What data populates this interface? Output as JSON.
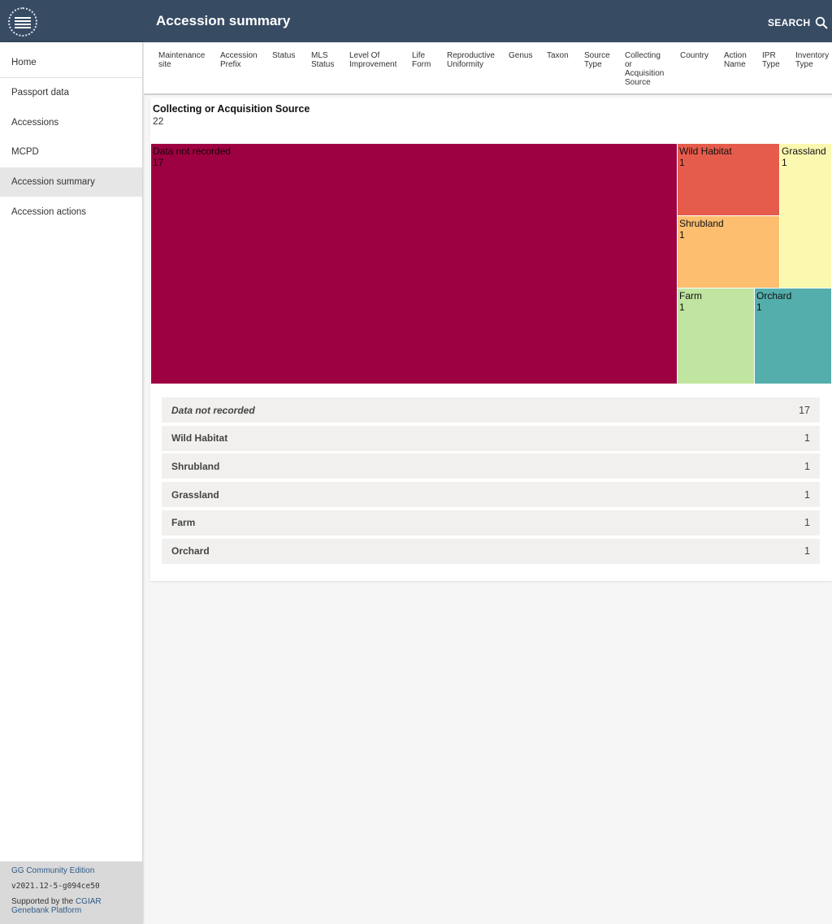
{
  "header": {
    "title": "Accession summary",
    "search_label": "SEARCH"
  },
  "sidebar": {
    "items": [
      {
        "label": "Home"
      },
      {
        "label": "Passport data"
      },
      {
        "label": "Accessions"
      },
      {
        "label": "MCPD"
      },
      {
        "label": "Accession summary",
        "active": true
      },
      {
        "label": "Accession actions"
      }
    ]
  },
  "footer": {
    "edition": "GG Community Edition",
    "version": "v2021.12-5-g094ce50",
    "supported_prefix": "Supported by the ",
    "supported_link": "CGIAR Genebank Platform"
  },
  "columns": [
    "Maintenance\nsite",
    "Accession\nPrefix",
    "Status",
    "MLS\nStatus",
    "Level Of\nImprovement",
    "Life\nForm",
    "Reproductive\nUniformity",
    "Genus",
    "Taxon",
    "Source\nType",
    "Collecting\nor\nAcquisition\nSource",
    "Country",
    "Action\nName",
    "IPR\nType",
    "Inventory\nType"
  ],
  "summary": {
    "title": "Collecting or Acquisition Source",
    "total": "22"
  },
  "chart_data": {
    "type": "treemap",
    "categories": [
      "Data not recorded",
      "Wild Habitat",
      "Shrubland",
      "Grassland",
      "Farm",
      "Orchard"
    ],
    "values": [
      17,
      1,
      1,
      1,
      1,
      1
    ],
    "colors": [
      "#9e0142",
      "#e65c4c",
      "#fdbe6f",
      "#fbf8b0",
      "#bfe5a0",
      "#54aeac"
    ]
  },
  "rows": [
    {
      "label": "Data not recorded",
      "count": "17",
      "italic": true
    },
    {
      "label": "Wild Habitat",
      "count": "1"
    },
    {
      "label": "Shrubland",
      "count": "1"
    },
    {
      "label": "Grassland",
      "count": "1"
    },
    {
      "label": "Farm",
      "count": "1"
    },
    {
      "label": "Orchard",
      "count": "1"
    }
  ]
}
